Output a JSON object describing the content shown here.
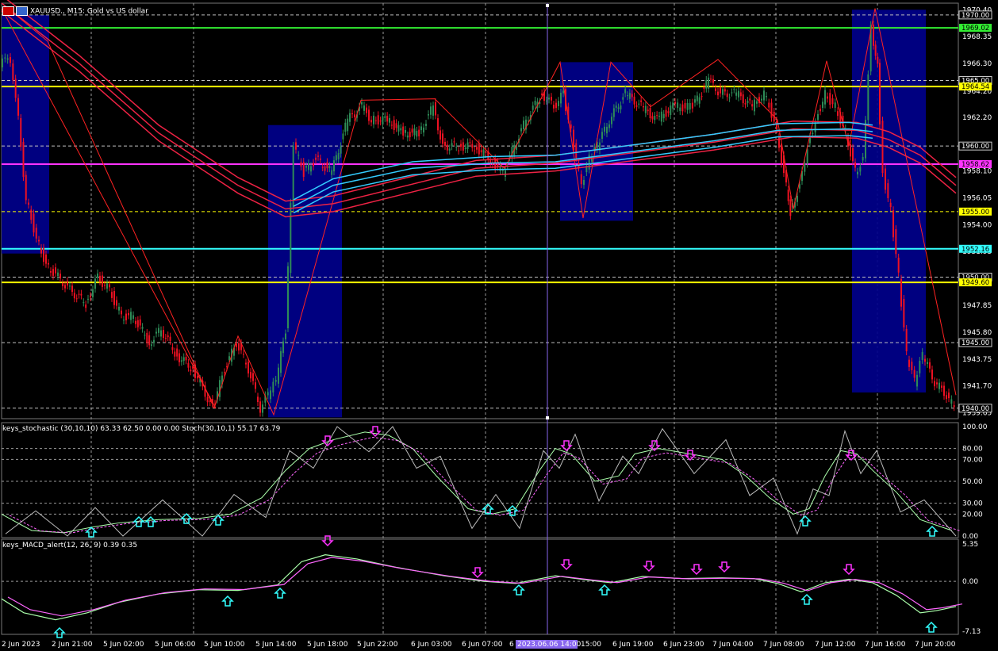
{
  "header": {
    "flag_icon": "uk-flag-icon",
    "flag_icon_2": "us-flag-icon",
    "symbol": "XAUUSD.,",
    "timeframe": "M15:",
    "description": "Gold vs US dollar"
  },
  "main_chart": {
    "price_axis": [
      "1970.40",
      "1968.35",
      "1966.30",
      "1964.20",
      "1962.20",
      "1960.10",
      "1958.10",
      "1956.05",
      "1954.00",
      "1951.95",
      "1949.90",
      "1947.85",
      "1945.80",
      "1943.75",
      "1941.70",
      "1939.65"
    ],
    "price_range": [
      1939.2,
      1970.9
    ],
    "levels": [
      {
        "price": 1970.0,
        "label": "1970.00",
        "color": "#c0c0c0",
        "style": "dash"
      },
      {
        "price": 1969.02,
        "label": "1969.02",
        "color": "#33ee33",
        "style": "solid"
      },
      {
        "price": 1965.0,
        "label": "1965.00",
        "color": "#c0c0c0",
        "style": "dash"
      },
      {
        "price": 1964.54,
        "label": "1964.54",
        "color": "#ffff00",
        "style": "solid"
      },
      {
        "price": 1960.0,
        "label": "1960.00",
        "color": "#c0c0c0",
        "style": "dash"
      },
      {
        "price": 1958.62,
        "label": "1958.62",
        "color": "#ff33ff",
        "style": "solid"
      },
      {
        "price": 1955.0,
        "label": "1955.00",
        "color": "#ffff00",
        "style": "dash"
      },
      {
        "price": 1952.16,
        "label": "1952.16",
        "color": "#33ffff",
        "style": "solid"
      },
      {
        "price": 1950.0,
        "label": "1950.00",
        "color": "#c0c0c0",
        "style": "dash"
      },
      {
        "price": 1949.6,
        "label": "1949.60",
        "color": "#ffff00",
        "style": "solid"
      },
      {
        "price": 1945.0,
        "label": "1945.00",
        "color": "#c0c0c0",
        "style": "dash"
      },
      {
        "price": 1940.0,
        "label": "1940.00",
        "color": "#c0c0c0",
        "style": "dash"
      }
    ],
    "colors": {
      "bull": "#2e8b57",
      "bear": "#ee1122",
      "zone": "#00008b",
      "ma_fast": "#33ccff",
      "ma_slow": "#ee2244",
      "zigzag": "#ff2222"
    }
  },
  "stochastic": {
    "title": "keys_stochastic (30,10,10) 63.33 62.50 0.00 0.00 Stoch(30,10,1) 55.17 63.79",
    "axis": [
      "100.00",
      "80.00",
      "70.00",
      "50.00",
      "30.00",
      "20.00",
      "0.00"
    ]
  },
  "macd": {
    "title": "keys_MACD_alert(12, 26, 9) 0.39 0.35",
    "axis": [
      "5.35",
      "0.00",
      "-7.13"
    ]
  },
  "time_axis": [
    "2 Jun 2023",
    "2 Jun 21:00",
    "5 Jun 02:00",
    "5 Jun 06:00",
    "5 Jun 10:00",
    "5 Jun 14:00",
    "5 Jun 18:00",
    "5 Jun 22:00",
    "6 Jun 03:00",
    "6 Jun 07:00",
    "6",
    "15:00",
    "6 Jun 19:00",
    "6 Jun 23:00",
    "7 Jun 04:00",
    "7 Jun 08:00",
    "7 Jun 12:00",
    "7 Jun 16:00",
    "7 Jun 20:00"
  ],
  "crosshair_time": "2023.06.06 14:00"
}
